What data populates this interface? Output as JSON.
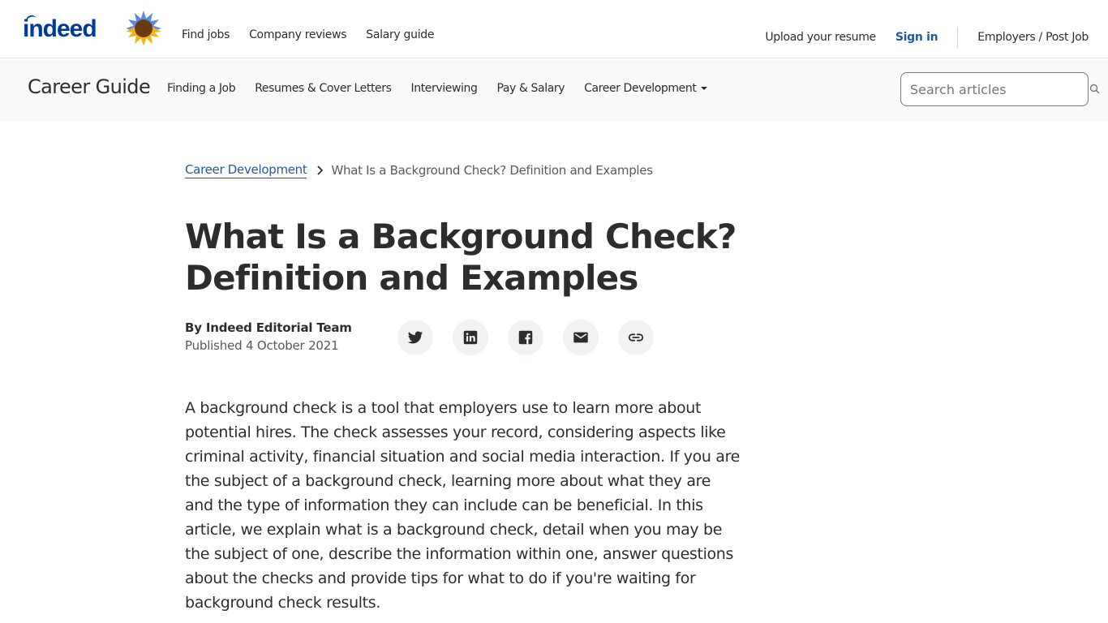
{
  "header": {
    "logo_text": "indeed",
    "nav": [
      {
        "label": "Find jobs"
      },
      {
        "label": "Company reviews"
      },
      {
        "label": "Salary guide"
      }
    ],
    "right": {
      "upload": "Upload your resume",
      "signin": "Sign in",
      "employers": "Employers / Post Job"
    }
  },
  "subnav": {
    "title": "Career Guide",
    "links": [
      {
        "label": "Finding a Job"
      },
      {
        "label": "Resumes & Cover Letters"
      },
      {
        "label": "Interviewing"
      },
      {
        "label": "Pay & Salary"
      },
      {
        "label": "Career Development"
      }
    ],
    "search": {
      "placeholder": "Search articles",
      "value": ""
    }
  },
  "breadcrumb": {
    "parent": "Career Development",
    "current": "What Is a Background Check? Definition and Examples"
  },
  "article": {
    "title": "What Is a Background Check? Definition and Examples",
    "author": "By Indeed Editorial Team",
    "published": "Published 4 October 2021",
    "share_icons": [
      "twitter-icon",
      "linkedin-icon",
      "facebook-icon",
      "email-icon",
      "link-icon"
    ],
    "intro": "A background check is a tool that employers use to learn more about potential hires. The check assesses your record, considering aspects like criminal activity, financial situation and social media interaction. If you are the subject of a background check, learning more about what they are and the type of information they can include can be beneficial. In this article, we explain what is a background check, detail when you may be the subject of one, describe the information within one, answer questions about the checks and provide tips for what to do if you're waiting for background check results."
  },
  "colors": {
    "brand": "#003a9b",
    "link": "#2557a7",
    "text": "#2d2d2d",
    "muted": "#595959",
    "subnav_bg": "#faf9f8"
  }
}
